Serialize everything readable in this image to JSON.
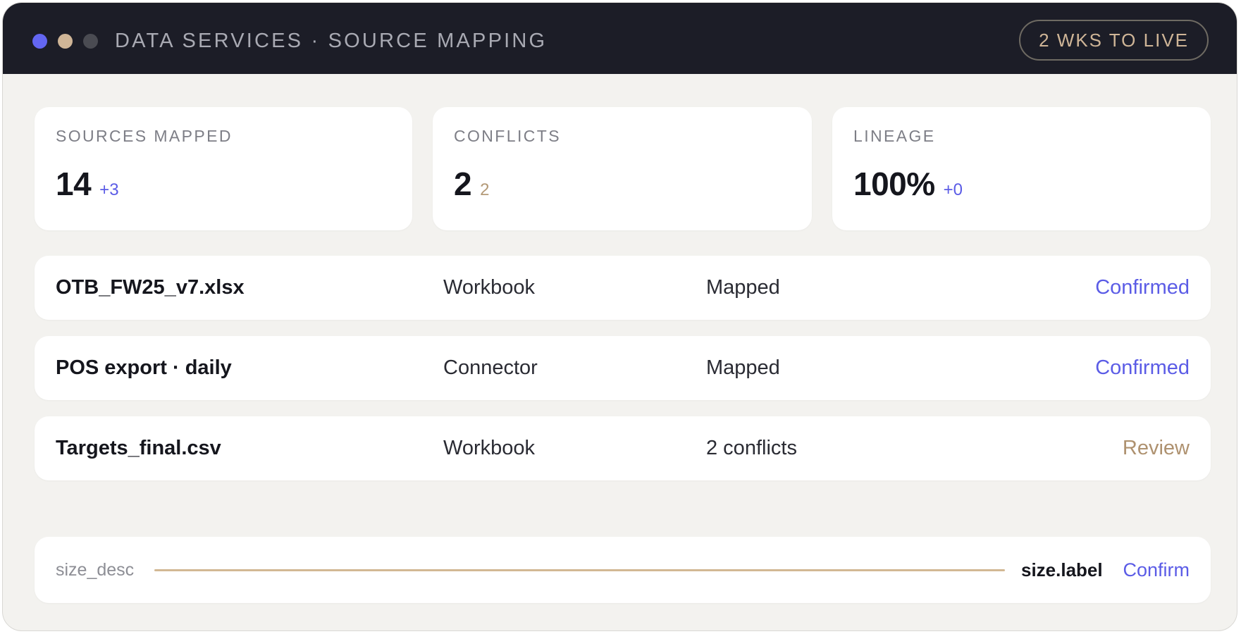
{
  "window": {
    "title": "DATA SERVICES · SOURCE MAPPING",
    "badge": "2 WKS TO LIVE",
    "dot_colors": [
      "#6366f1",
      "#cfb597",
      "#4a4b52"
    ]
  },
  "stats": [
    {
      "label": "SOURCES MAPPED",
      "value": "14",
      "delta": "+3",
      "delta_color": "#5b5ce6"
    },
    {
      "label": "CONFLICTS",
      "value": "2",
      "delta": "2",
      "delta_color": "#b49a78"
    },
    {
      "label": "LINEAGE",
      "value": "100%",
      "delta": "+0",
      "delta_color": "#5b5ce6"
    }
  ],
  "sources": [
    {
      "name": "OTB_FW25_v7.xlsx",
      "kind": "Workbook",
      "state": "Mapped",
      "action": "Confirmed",
      "action_color": "#5b5ce6"
    },
    {
      "name": "POS export · daily",
      "kind": "Connector",
      "state": "Mapped",
      "action": "Confirmed",
      "action_color": "#5b5ce6"
    },
    {
      "name": "Targets_final.csv",
      "kind": "Workbook",
      "state": "2 conflicts",
      "action": "Review",
      "action_color": "#ae916f"
    }
  ],
  "size": {
    "desc": "size_desc",
    "label": "size.label",
    "confirm": "Confirm",
    "line_color": "#d2b894"
  }
}
